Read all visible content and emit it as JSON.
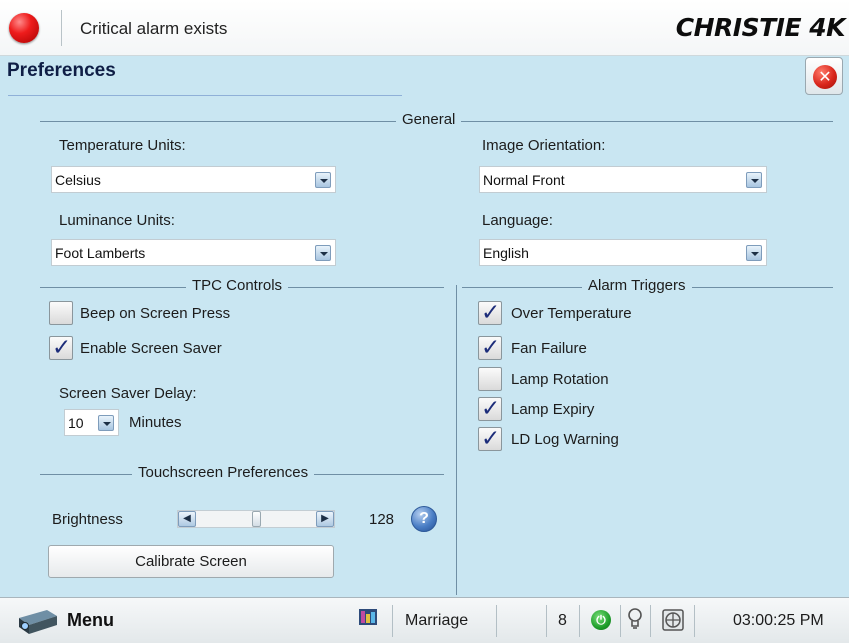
{
  "header": {
    "alarm_text": "Critical alarm exists",
    "logo_text": "CHRISTIE 4K",
    "status_color": "#e81c1c"
  },
  "page": {
    "title": "Preferences",
    "close_icon": "close-icon"
  },
  "general": {
    "group_label": "General",
    "temperature_units": {
      "label": "Temperature Units:",
      "value": "Celsius"
    },
    "luminance_units": {
      "label": "Luminance Units:",
      "value": "Foot Lamberts"
    },
    "image_orientation": {
      "label": "Image Orientation:",
      "value": "Normal Front"
    },
    "language": {
      "label": "Language:",
      "value": "English"
    }
  },
  "tpc_controls": {
    "group_label": "TPC Controls",
    "beep": {
      "label": "Beep on Screen Press",
      "checked": false
    },
    "screen_saver": {
      "label": "Enable Screen Saver",
      "checked": true
    },
    "delay": {
      "label": "Screen Saver Delay:",
      "value": "10",
      "unit": "Minutes"
    }
  },
  "touchscreen": {
    "group_label": "Touchscreen Preferences",
    "brightness_label": "Brightness",
    "brightness_value": "128",
    "brightness_fraction": 0.5,
    "calibrate_label": "Calibrate Screen"
  },
  "alarm_triggers": {
    "group_label": "Alarm Triggers",
    "items": [
      {
        "label": "Over Temperature",
        "checked": true
      },
      {
        "label": "Fan Failure",
        "checked": true
      },
      {
        "label": "Lamp Rotation",
        "checked": false
      },
      {
        "label": "Lamp Expiry",
        "checked": true
      },
      {
        "label": "LD Log Warning",
        "checked": true
      }
    ]
  },
  "footer": {
    "menu_label": "Menu",
    "channel_name": "Marriage",
    "channel_number": "8",
    "time": "03:00:25 PM"
  }
}
